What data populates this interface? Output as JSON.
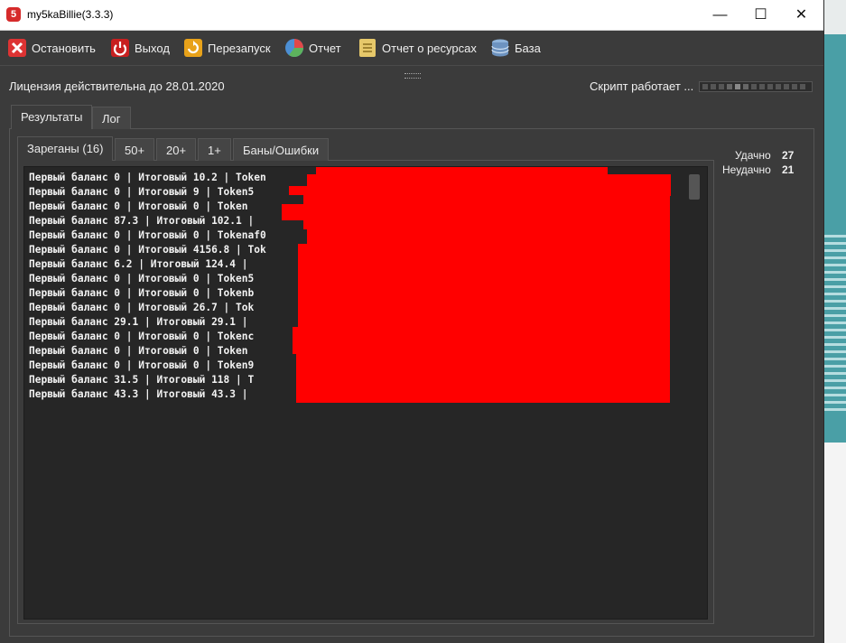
{
  "window": {
    "title": "my5kaBillie(3.3.3)",
    "app_icon_glyph": "5",
    "minimize_glyph": "—",
    "maximize_glyph": "☐",
    "close_glyph": "✕"
  },
  "toolbar": {
    "stop": "Остановить",
    "exit": "Выход",
    "restart": "Перезапуск",
    "report": "Отчет",
    "resource_report": "Отчет о ресурсах",
    "database": "База"
  },
  "license_text": "Лицензия действительна до 28.01.2020",
  "status_text": "Скрипт работает ...",
  "outer_tabs": [
    "Результаты",
    "Лог"
  ],
  "inner_tabs": [
    "Зареганы (16)",
    "50+",
    "20+",
    "1+",
    "Баны/Ошибки"
  ],
  "results": {
    "lines": [
      "Первый баланс 0 | Итоговый 10.2 | Token",
      "Первый баланс 0 | Итоговый 9 | Token5",
      "Первый баланс 0 | Итоговый 0 | Token",
      "Первый баланс 87.3 | Итоговый 102.1 |",
      "Первый баланс 0 | Итоговый 0 | Tokenaf0",
      "Первый баланс 0 | Итоговый 4156.8 | Tok",
      "Первый баланс 6.2 | Итоговый 124.4 |",
      "Первый баланс 0 | Итоговый 0 | Token5",
      "Первый баланс 0 | Итоговый 0 | Tokenb",
      "Первый баланс 0 | Итоговый 26.7 | Tok",
      "Первый баланс 29.1 | Итоговый 29.1 |",
      "Первый баланс 0 | Итоговый 0 | Tokenc",
      "Первый баланс 0 | Итоговый 0 | Token",
      "Первый баланс 0 | Итоговый 0 | Token9",
      "Первый баланс 31.5 | Итоговый 118 | T",
      "Первый баланс 43.3 | Итоговый 43.3 |"
    ]
  },
  "stats": {
    "success_label": "Удачно",
    "success_value": "27",
    "fail_label": "Неудачно",
    "fail_value": "21"
  },
  "colors": {
    "background": "#3b3b3b",
    "console_bg": "#262626",
    "redaction": "#ff0000",
    "desktop_accent": "#4a9fa6"
  }
}
